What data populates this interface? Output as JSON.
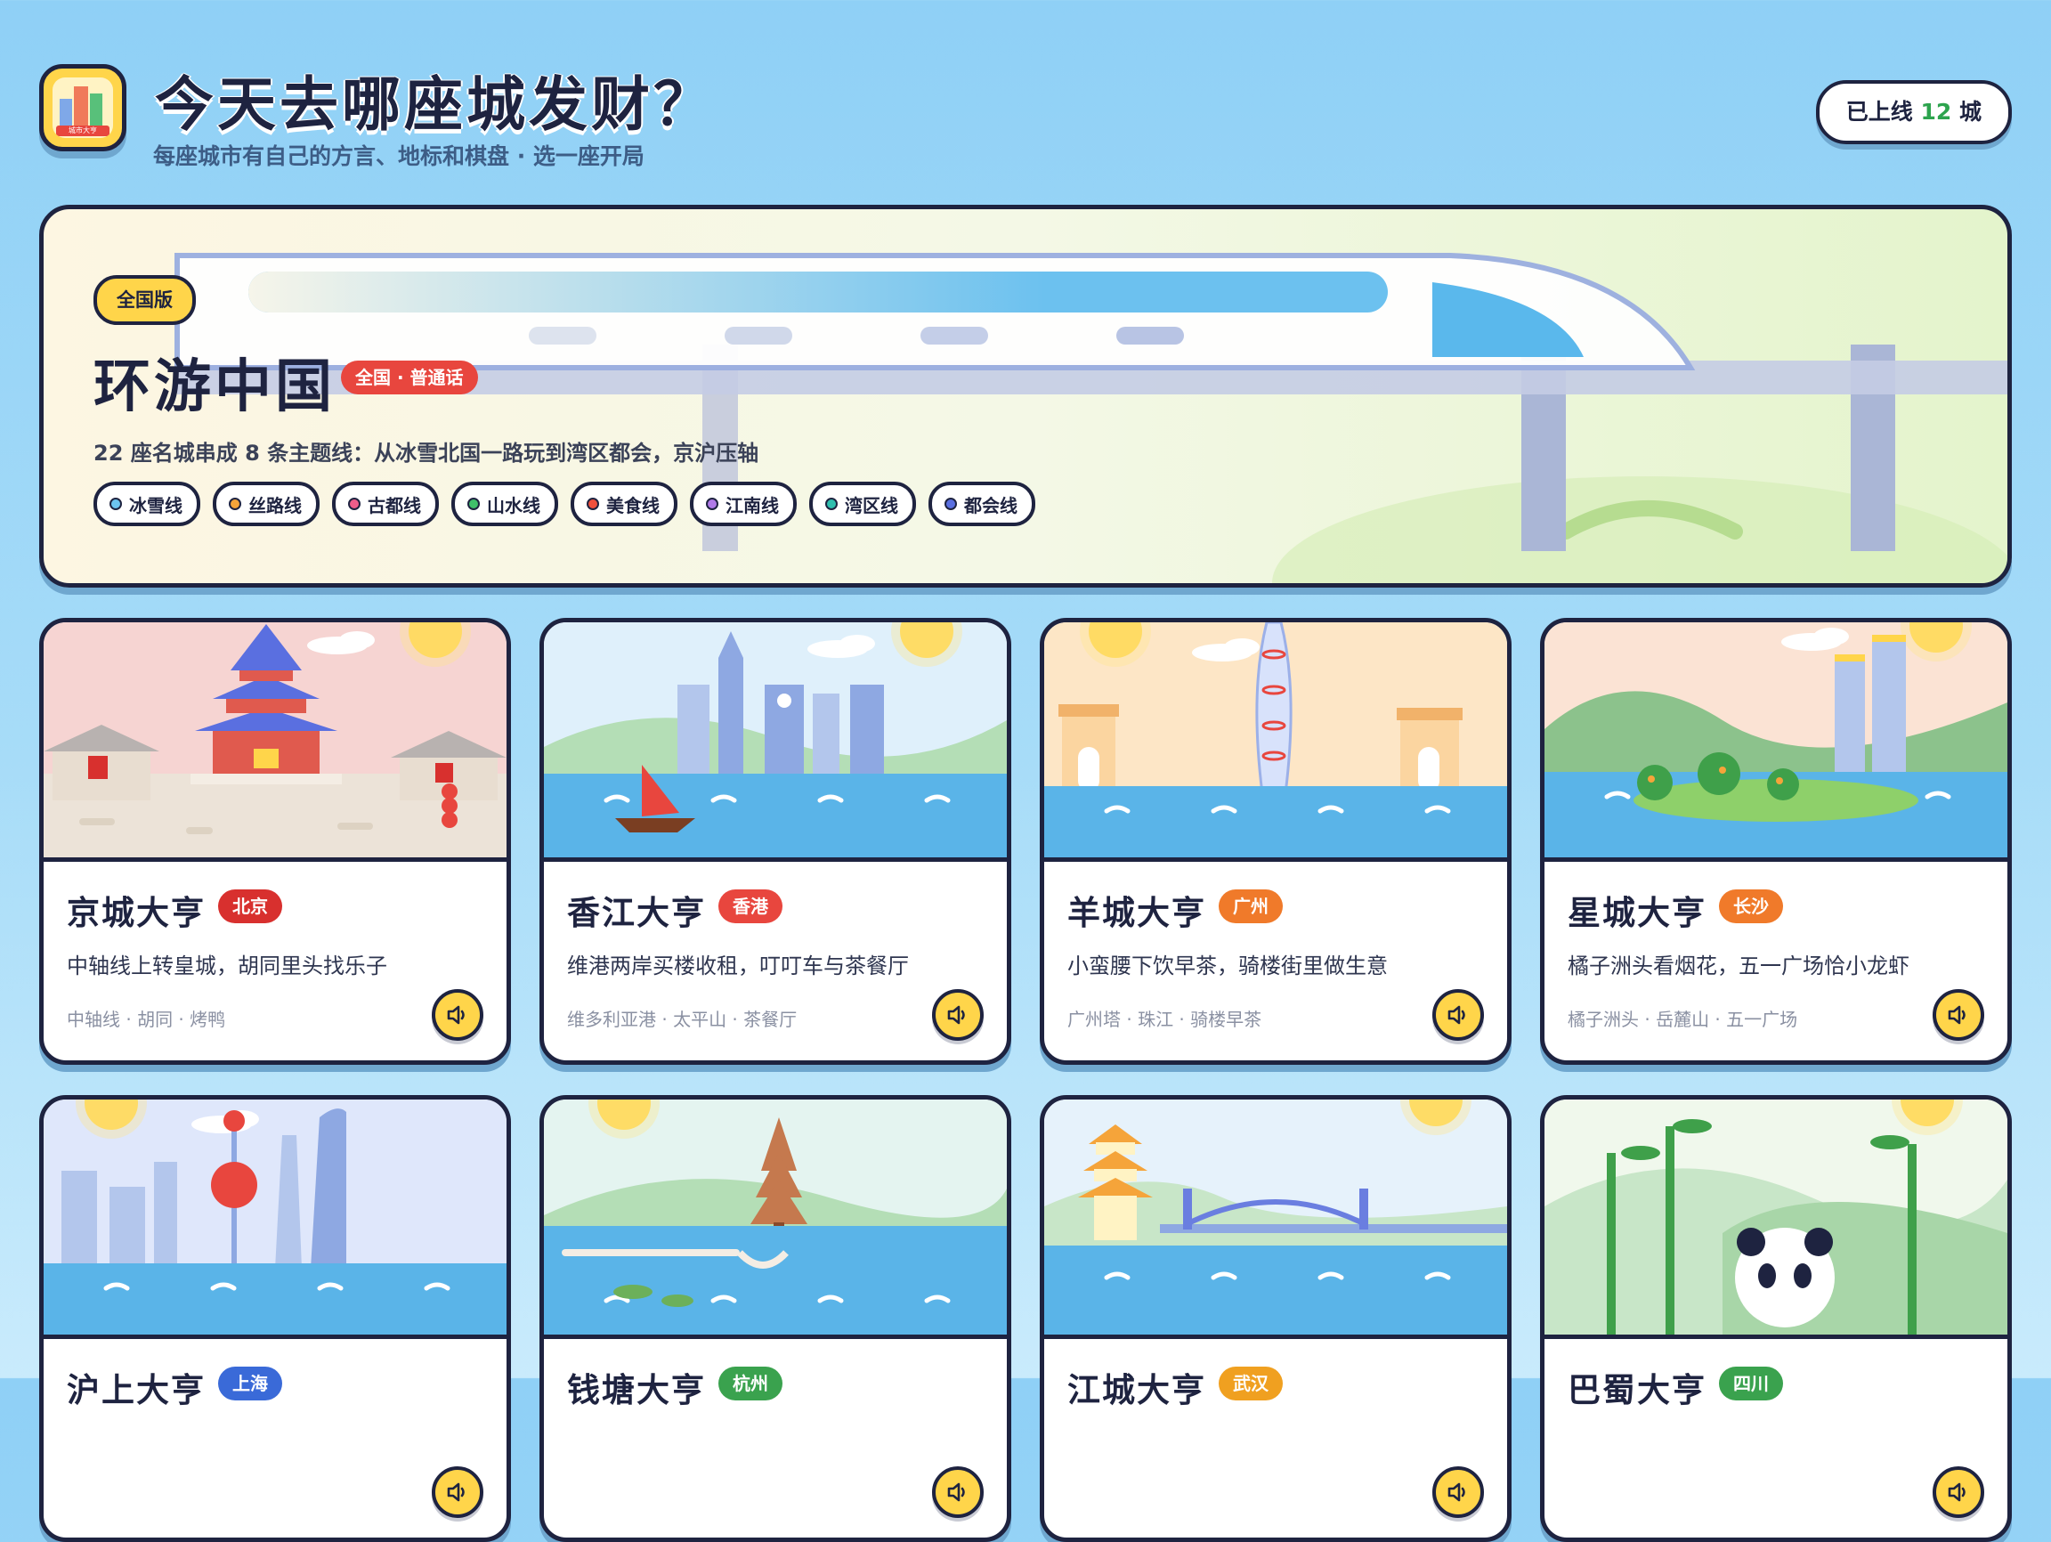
{
  "header": {
    "title": "今天去哪座城发财？",
    "subtitle": "每座城市有自己的方言、地标和棋盘 · 选一座开局",
    "online_prefix": "已上线",
    "online_count": "12",
    "online_suffix": "城",
    "app_icon_label": "城市大亨"
  },
  "hero": {
    "tag": "全国版",
    "title": "环游中国",
    "badge": "全国 · 普通话",
    "description": "22 座名城串成 8 条主题线：从冰雪北国一路玩到湾区都会，京沪压轴",
    "lines": [
      {
        "label": "冰雪线",
        "color": "#6cc4f0"
      },
      {
        "label": "丝路线",
        "color": "#f5a43a"
      },
      {
        "label": "古都线",
        "color": "#ef5d8a"
      },
      {
        "label": "山水线",
        "color": "#3fbf6a"
      },
      {
        "label": "美食线",
        "color": "#f0503c"
      },
      {
        "label": "江南线",
        "color": "#b07ae8"
      },
      {
        "label": "湾区线",
        "color": "#2fbfae"
      },
      {
        "label": "都会线",
        "color": "#5a6fe0"
      }
    ]
  },
  "cities": [
    {
      "name": "京城大亨",
      "badge": "北京",
      "badge_color": "#d8302e",
      "desc": "中轴线上转皇城，胡同里头找乐子",
      "tags": "中轴线 · 胡同 · 烤鸭",
      "scene": "beijing"
    },
    {
      "name": "香江大亨",
      "badge": "香港",
      "badge_color": "#e8463e",
      "desc": "维港两岸买楼收租，叮叮车与茶餐厅",
      "tags": "维多利亚港 · 太平山 · 茶餐厅",
      "scene": "hongkong"
    },
    {
      "name": "羊城大亨",
      "badge": "广州",
      "badge_color": "#f07a2a",
      "desc": "小蛮腰下饮早茶，骑楼街里做生意",
      "tags": "广州塔 · 珠江 · 骑楼早茶",
      "scene": "guangzhou"
    },
    {
      "name": "星城大亨",
      "badge": "长沙",
      "badge_color": "#f07a2a",
      "desc": "橘子洲头看烟花，五一广场恰小龙虾",
      "tags": "橘子洲头 · 岳麓山 · 五一广场",
      "scene": "changsha"
    },
    {
      "name": "沪上大亨",
      "badge": "上海",
      "badge_color": "#3a6ad8",
      "desc": "",
      "tags": "",
      "scene": "shanghai"
    },
    {
      "name": "钱塘大亨",
      "badge": "杭州",
      "badge_color": "#3aa24e",
      "desc": "",
      "tags": "",
      "scene": "hangzhou"
    },
    {
      "name": "江城大亨",
      "badge": "武汉",
      "badge_color": "#f0a020",
      "desc": "",
      "tags": "",
      "scene": "wuhan"
    },
    {
      "name": "巴蜀大亨",
      "badge": "四川",
      "badge_color": "#3aa24e",
      "desc": "",
      "tags": "",
      "scene": "sichuan"
    }
  ]
}
